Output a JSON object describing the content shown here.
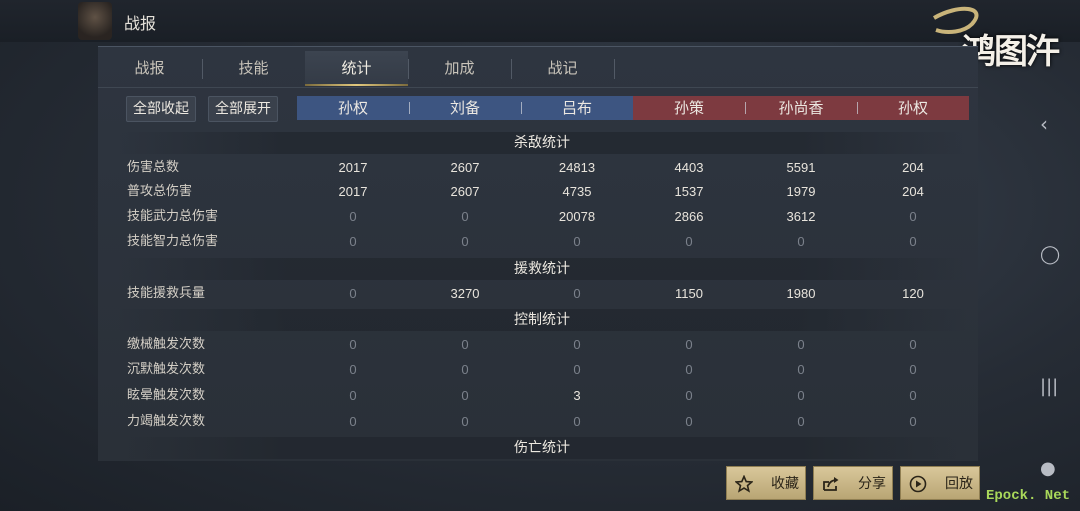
{
  "window": {
    "title": "战报"
  },
  "logo": {
    "text": "鸿图汻"
  },
  "tabs": [
    {
      "label": "战报"
    },
    {
      "label": "技能"
    },
    {
      "label": "统计"
    },
    {
      "label": "加成"
    },
    {
      "label": "战记"
    }
  ],
  "active_tab": "统计",
  "buttons": {
    "collapse_all": "全部收起",
    "expand_all": "全部展开"
  },
  "heroes": [
    {
      "name": "孙权",
      "side": "blue"
    },
    {
      "name": "刘备",
      "side": "blue"
    },
    {
      "name": "吕布",
      "side": "blue"
    },
    {
      "name": "孙策",
      "side": "red"
    },
    {
      "name": "孙尚香",
      "side": "red"
    },
    {
      "name": "孙权",
      "side": "red"
    }
  ],
  "sections": {
    "kill": {
      "title": "杀敌统计",
      "rows": [
        {
          "label": "伤害总数",
          "values": [
            "2017",
            "2607",
            "24813",
            "4403",
            "5591",
            "204"
          ]
        },
        {
          "label": "普攻总伤害",
          "values": [
            "2017",
            "2607",
            "4735",
            "1537",
            "1979",
            "204"
          ]
        },
        {
          "label": "技能武力总伤害",
          "values": [
            "0",
            "0",
            "20078",
            "2866",
            "3612",
            "0"
          ]
        },
        {
          "label": "技能智力总伤害",
          "values": [
            "0",
            "0",
            "0",
            "0",
            "0",
            "0"
          ]
        }
      ]
    },
    "rescue": {
      "title": "援救统计",
      "rows": [
        {
          "label": "技能援救兵量",
          "values": [
            "0",
            "3270",
            "0",
            "1150",
            "1980",
            "120"
          ]
        }
      ]
    },
    "control": {
      "title": "控制统计",
      "rows": [
        {
          "label": "缴械触发次数",
          "values": [
            "0",
            "0",
            "0",
            "0",
            "0",
            "0"
          ]
        },
        {
          "label": "沉默触发次数",
          "values": [
            "0",
            "0",
            "0",
            "0",
            "0",
            "0"
          ]
        },
        {
          "label": "眩晕触发次数",
          "values": [
            "0",
            "0",
            "3",
            "0",
            "0",
            "0"
          ]
        },
        {
          "label": "力竭触发次数",
          "values": [
            "0",
            "0",
            "0",
            "0",
            "0",
            "0"
          ]
        }
      ]
    },
    "casualty": {
      "title": "伤亡统计"
    }
  },
  "actions": {
    "favorite": {
      "label": "收藏",
      "icon": "star-icon"
    },
    "share": {
      "label": "分享",
      "icon": "share-icon"
    },
    "replay": {
      "label": "回放",
      "icon": "play-icon"
    }
  },
  "watermark": "Epock. Net",
  "colors": {
    "blue_team": "#3d5581",
    "red_team": "#7d3a40",
    "accent_gold": "#e2c97e",
    "action_bg": "#d9c79a"
  }
}
